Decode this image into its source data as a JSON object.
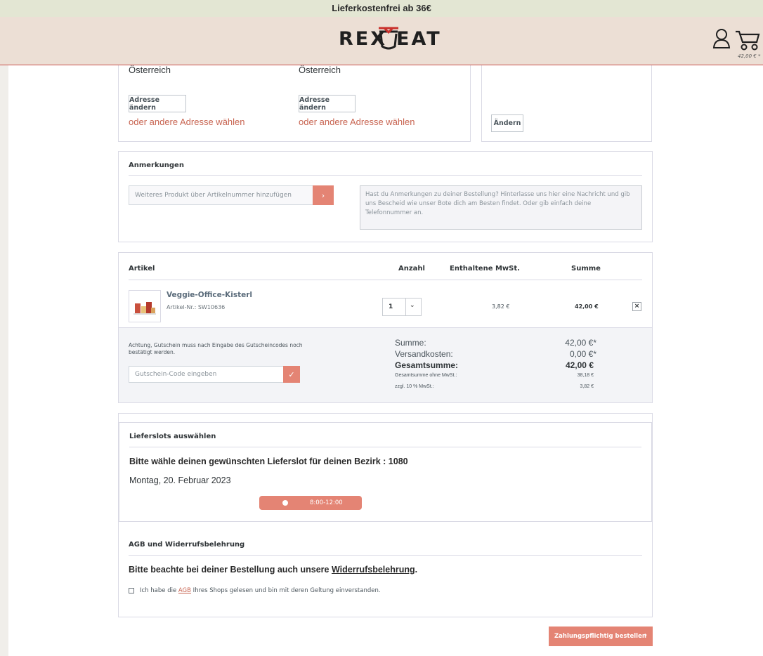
{
  "topbar": {
    "text": "Lieferkostenfrei ab 36€"
  },
  "header": {
    "logo_left": "REX",
    "logo_right": "EAT",
    "cart_total": "42,00 € *"
  },
  "addresses": {
    "billing_country": "Österreich",
    "shipping_country": "Österreich",
    "change_address_label": "Adresse ändern",
    "other_address_label": "oder andere Adresse wählen",
    "change_label": "Ändern"
  },
  "remarks": {
    "title": "Anmerkungen",
    "product_placeholder": "Weiteres Produkt über Artikelnummer hinzufügen",
    "textarea_placeholder": "Hast du Anmerkungen zu deiner Bestellung? Hinterlasse uns hier eine Nachricht und gib uns Bescheid wie unser Bote dich am Besten findet. Oder gib einfach deine Telefonnummer an."
  },
  "cart": {
    "headers": {
      "article": "Artikel",
      "quantity": "Anzahl",
      "tax": "Enthaltene MwSt.",
      "sum": "Summe"
    },
    "item": {
      "name": "Veggie-Office-Kisterl",
      "sku": "Artikel-Nr.: SW10636",
      "quantity": "1",
      "tax": "3,82 €",
      "sum": "42,00 €"
    }
  },
  "summary": {
    "voucher_note": "Achtung, Gutschein muss nach Eingabe des Gutscheincodes noch bestätigt werden.",
    "voucher_placeholder": "Gutschein-Code eingeben",
    "rows": {
      "sum_label": "Summe:",
      "sum_value": "42,00 €*",
      "shipping_label": "Versandkosten:",
      "shipping_value": "0,00 €*",
      "total_label": "Gesamtsumme:",
      "total_value": "42,00 €",
      "net_label": "Gesamtsumme ohne MwSt.:",
      "net_value": "38,18 €",
      "vat_label": "zzgl. 10 % MwSt.:",
      "vat_value": "3,82 €"
    }
  },
  "delivery": {
    "title": "Lieferslots auswählen",
    "heading": "Bitte wähle deinen gewünschten Lieferslot für deinen Bezirk : 1080",
    "date": "Montag, 20. Februar 2023",
    "slot": "8:00-12:00"
  },
  "agb": {
    "title": "AGB und Widerrufsbelehrung",
    "notice_prefix": "Bitte beachte bei deiner Bestellung auch unsere ",
    "notice_link": "Widerrufsbelehrung",
    "notice_suffix": ".",
    "check_prefix": "Ich habe die ",
    "check_link": "AGB",
    "check_suffix": " Ihres Shops gelesen und bin mit deren Geltung einverstanden."
  },
  "order_button": "Zahlungspflichtig bestellen",
  "colors": {
    "accent": "#e48474",
    "link": "#c86552",
    "header_bg": "#ecdfd5",
    "topbar_bg": "#e3e6d3"
  }
}
